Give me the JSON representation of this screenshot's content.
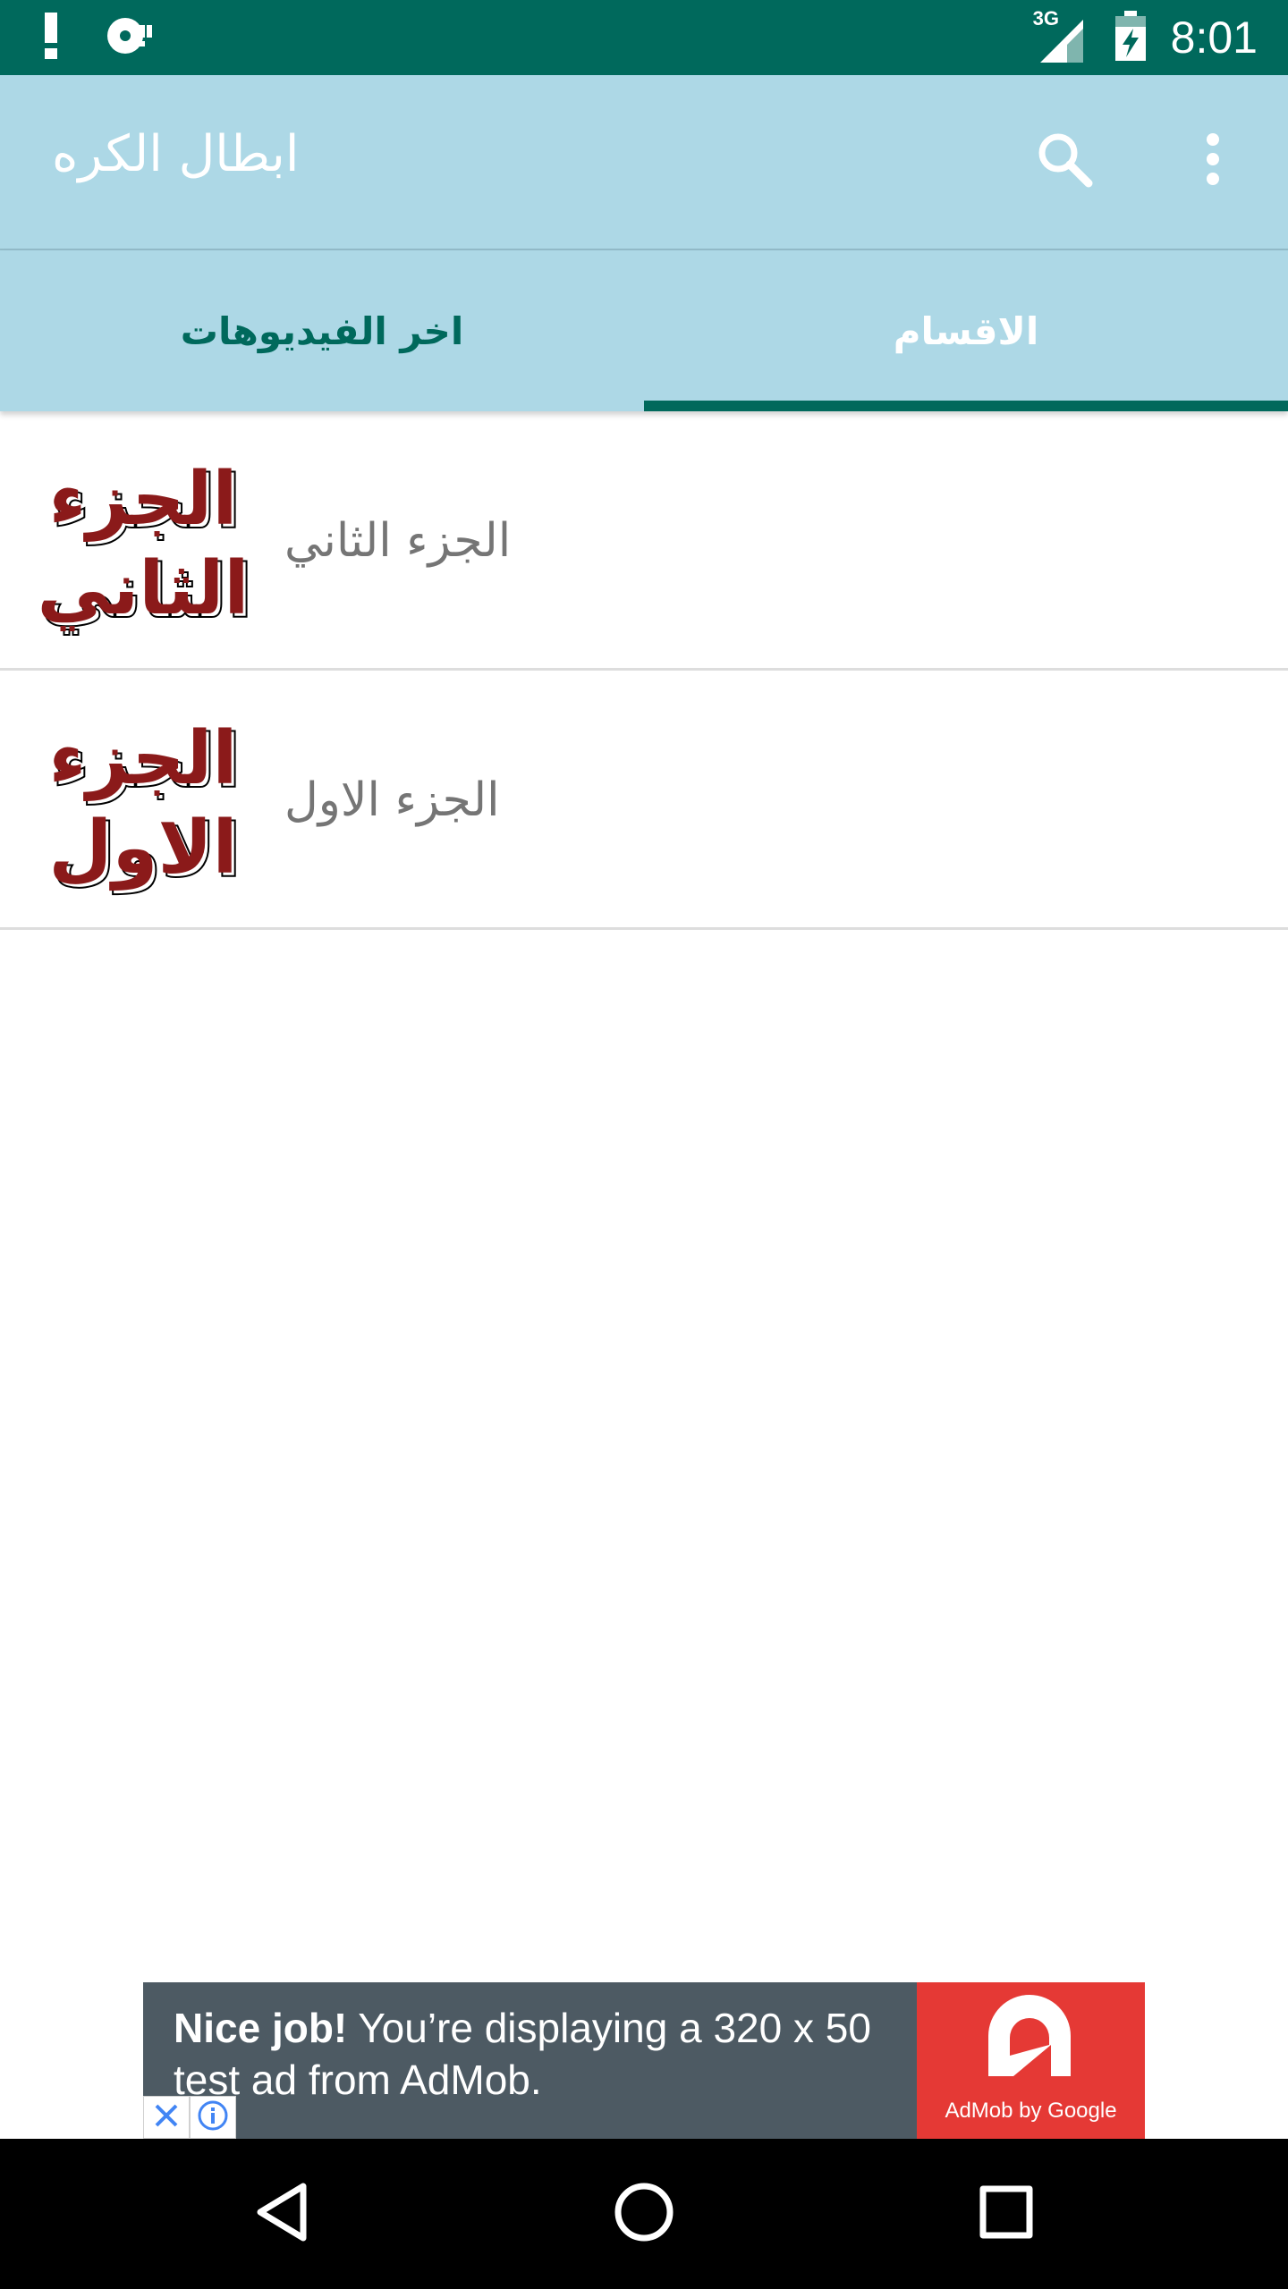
{
  "status_bar": {
    "time": "8:01",
    "network": "3G",
    "icons": [
      "alert-icon",
      "media-sync-icon",
      "cell-signal-icon",
      "battery-charging-icon"
    ]
  },
  "app_bar": {
    "title": "ابطال الكره",
    "icons": [
      "search-icon",
      "more-vert-icon"
    ]
  },
  "tabs": [
    {
      "label": "الاقسام",
      "selected": true
    },
    {
      "label": "اخر الفيديوهات",
      "selected": false
    }
  ],
  "list": {
    "items": [
      {
        "label": "الجزء الثاني",
        "thumb_lines": [
          "الجزء",
          "الثاني"
        ]
      },
      {
        "label": "الجزء الاول",
        "thumb_lines": [
          "الجزء",
          "الاول"
        ]
      }
    ]
  },
  "ad": {
    "headline": "Nice job!",
    "body": " You’re displaying a 320 x 50 test ad from AdMob.",
    "logo_caption": "AdMob by Google"
  },
  "colors": {
    "status_bar": "#00695c",
    "app_bar": "#add8e6",
    "tab_indicator": "#00695c",
    "thumb_text": "#8b1a1a",
    "ad_background": "#4d5a63",
    "ad_logo": "#e53935"
  }
}
